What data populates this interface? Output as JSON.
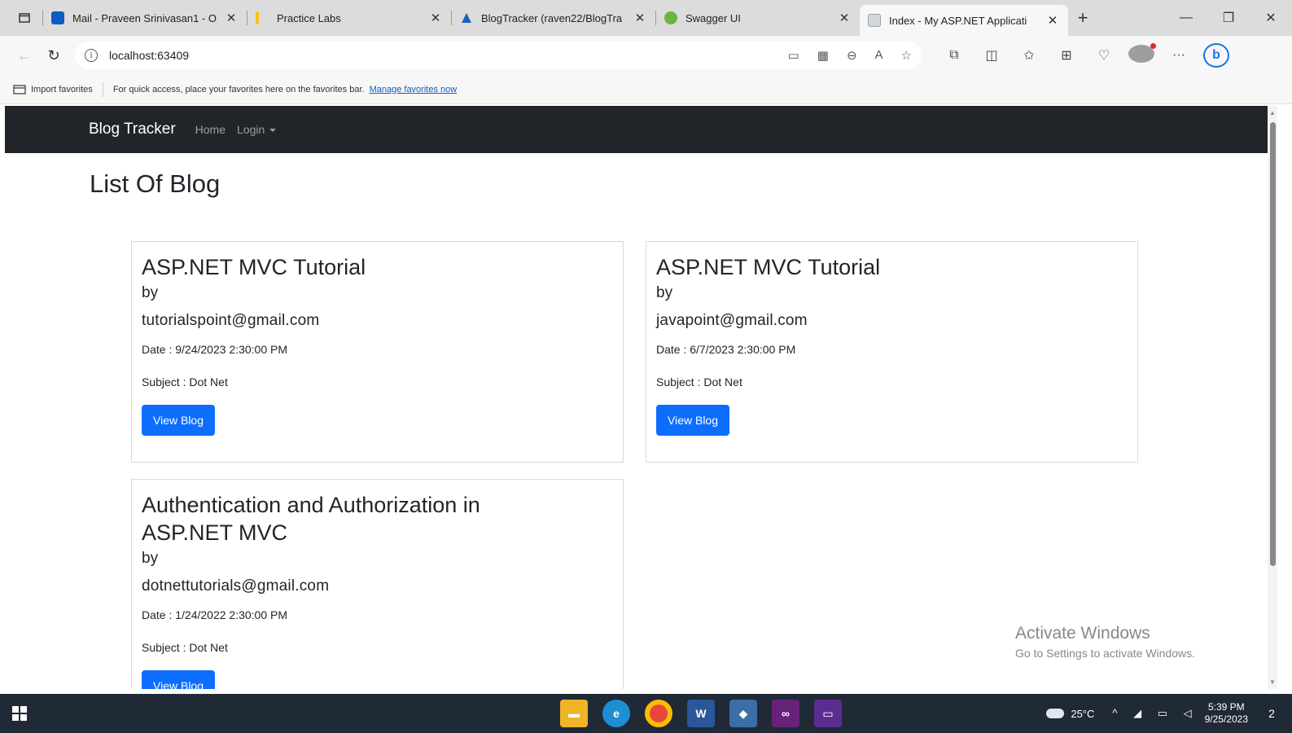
{
  "browser": {
    "tabs": [
      {
        "title": "Mail - Praveen Srinivasan1 - O",
        "favicon_color": "#0a5bc4"
      },
      {
        "title": "Practice Labs",
        "favicon_color": "#f5c518"
      },
      {
        "title": "BlogTracker (raven22/BlogTra",
        "favicon_color": "#1565c0"
      },
      {
        "title": "Swagger UI",
        "favicon_color": "#6db33f"
      },
      {
        "title": "Index - My ASP.NET Applicati",
        "favicon_color": "#90a4ae"
      }
    ],
    "url": "localhost:63409",
    "favorites_bar": {
      "import_label": "Import favorites",
      "message": "For quick access, place your favorites here on the favorites bar.",
      "manage_link": "Manage favorites now"
    }
  },
  "site": {
    "brand": "Blog Tracker",
    "nav": {
      "home": "Home",
      "login": "Login"
    },
    "page_title": "List Of Blog",
    "accent_color": "#0d6efd"
  },
  "blogs": [
    {
      "title": "ASP.NET MVC Tutorial",
      "by": "by",
      "author": "tutorialspoint@gmail.com",
      "date": "Date : 9/24/2023 2:30:00 PM",
      "subject": "Subject : Dot Net",
      "button": "View Blog"
    },
    {
      "title": "ASP.NET MVC Tutorial",
      "by": "by",
      "author": "javapoint@gmail.com",
      "date": "Date : 6/7/2023 2:30:00 PM",
      "subject": "Subject : Dot Net",
      "button": "View Blog"
    },
    {
      "title": "Authentication and Authorization in ASP.NET MVC",
      "by": "by",
      "author": "dotnettutorials@gmail.com",
      "date": "Date : 1/24/2022 2:30:00 PM",
      "subject": "Subject : Dot Net",
      "button": "View Blog"
    }
  ],
  "watermark": {
    "line1": "Activate Windows",
    "line2": "Go to Settings to activate Windows."
  },
  "taskbar": {
    "temperature": "25°C",
    "time": "5:39 PM",
    "date": "9/25/2023",
    "notifications": "2"
  }
}
